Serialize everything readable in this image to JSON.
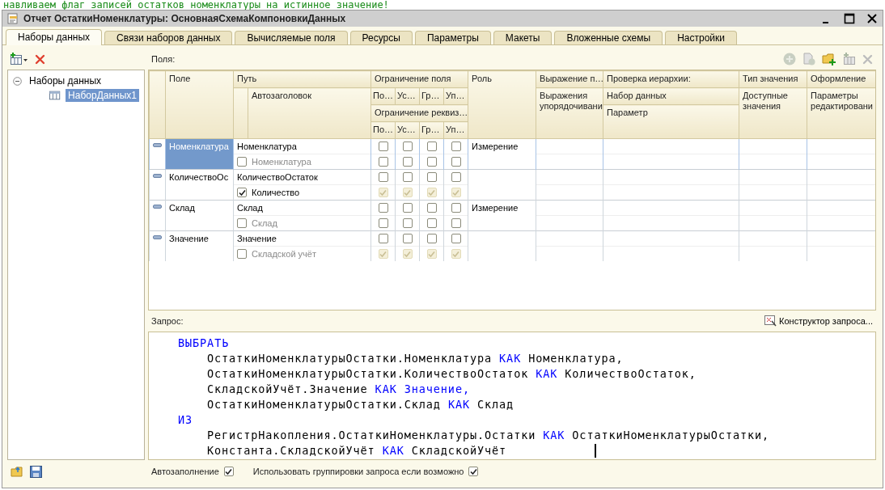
{
  "caption_above": "навливаем флаг записей остатков номенклатуры на истинное значение!",
  "window": {
    "title": "Отчет ОстаткиНоменклатуры: ОсновнаяСхемаКомпоновкиДанных"
  },
  "tabs": [
    {
      "label": "Наборы данных",
      "selected": true
    },
    {
      "label": "Связи наборов данных",
      "selected": false
    },
    {
      "label": "Вычисляемые поля",
      "selected": false
    },
    {
      "label": "Ресурсы",
      "selected": false
    },
    {
      "label": "Параметры",
      "selected": false
    },
    {
      "label": "Макеты",
      "selected": false
    },
    {
      "label": "Вложенные схемы",
      "selected": false
    },
    {
      "label": "Настройки",
      "selected": false
    }
  ],
  "tree": {
    "label": "Наборы данных",
    "expanded": true,
    "children": [
      {
        "label": "НаборДанных1",
        "selected": true
      }
    ]
  },
  "fields_label": "Поля:",
  "table": {
    "header": {
      "field": "Поле",
      "path": "Путь",
      "title": "Автозаголовок",
      "field_restriction": "Ограничение поля",
      "field_restriction_columns": [
        "По…",
        "Ус…",
        "Гр…",
        "Уп…"
      ],
      "attr_restriction": "Ограничение реквиз…",
      "attr_restriction_columns": [
        "По…",
        "Ус…",
        "Гр…",
        "Уп…"
      ],
      "role": "Роль",
      "expression": "Выражение п…",
      "order_expression": "Выражения упорядочивани",
      "hierarchy": "Проверка иерархии:",
      "hierarchy_set": "Набор данных",
      "hierarchy_param": "Параметр",
      "value_type": "Тип значения",
      "available_values": "Доступные значения",
      "appearance": "Оформление",
      "edit_params": "Параметры редактировани"
    },
    "rows": [
      {
        "field": "Номенклатура",
        "selected": true,
        "path": "Номенклатура",
        "title": "Номенклатура",
        "title_checked": false,
        "field_restrictions": [
          {
            "checked": false
          },
          {
            "checked": false
          },
          {
            "checked": false
          },
          {
            "checked": false
          }
        ],
        "attr_restrictions": [
          {
            "checked": false,
            "disabled": false
          },
          {
            "checked": false,
            "disabled": false
          },
          {
            "checked": false,
            "disabled": false
          },
          {
            "checked": false,
            "disabled": false
          }
        ],
        "role": "Измерение"
      },
      {
        "field": "КоличествоОс",
        "selected": false,
        "path": "КоличествоОстаток",
        "title": "Количество",
        "title_checked": true,
        "field_restrictions": [
          {
            "checked": false
          },
          {
            "checked": false
          },
          {
            "checked": false
          },
          {
            "checked": false
          }
        ],
        "attr_restrictions": [
          {
            "checked": true,
            "disabled": true
          },
          {
            "checked": true,
            "disabled": true
          },
          {
            "checked": true,
            "disabled": true
          },
          {
            "checked": true,
            "disabled": true
          }
        ]
      },
      {
        "field": "Склад",
        "selected": false,
        "path": "Склад",
        "title": "Склад",
        "title_checked": false,
        "field_restrictions": [
          {
            "checked": false
          },
          {
            "checked": false
          },
          {
            "checked": false
          },
          {
            "checked": false
          }
        ],
        "attr_restrictions": [
          {
            "checked": false,
            "disabled": false
          },
          {
            "checked": false,
            "disabled": false
          },
          {
            "checked": false,
            "disabled": false
          },
          {
            "checked": false,
            "disabled": false
          }
        ],
        "role": "Измерение"
      },
      {
        "field": "Значение",
        "selected": false,
        "path": "Значение",
        "title": "Складской учёт",
        "title_checked": false,
        "field_restrictions": [
          {
            "checked": false
          },
          {
            "checked": false
          },
          {
            "checked": false
          },
          {
            "checked": false
          }
        ],
        "attr_restrictions": [
          {
            "checked": true,
            "disabled": true
          },
          {
            "checked": true,
            "disabled": true
          },
          {
            "checked": true,
            "disabled": true
          },
          {
            "checked": true,
            "disabled": true
          }
        ]
      }
    ]
  },
  "query": {
    "label": "Запрос:",
    "constructor": "Конструктор запроса...",
    "lines": [
      {
        "indented": false,
        "tokens": [
          {
            "text": "ВЫБРАТЬ",
            "kind": "keyword"
          }
        ]
      },
      {
        "indented": true,
        "tokens": [
          {
            "text": "ОстаткиНоменклатурыОстатки.Номенклатура",
            "kind": "name"
          },
          {
            "text": "КАК",
            "kind": "keyword"
          },
          {
            "text": "Номенклатура,",
            "kind": "name"
          }
        ]
      },
      {
        "indented": true,
        "tokens": [
          {
            "text": "ОстаткиНоменклатурыОстатки.КоличествоОстаток",
            "kind": "name"
          },
          {
            "text": "КАК",
            "kind": "keyword"
          },
          {
            "text": "КоличествоОстаток,",
            "kind": "name"
          }
        ]
      },
      {
        "indented": true,
        "tokens": [
          {
            "text": "СкладскойУчёт.Значение",
            "kind": "name"
          },
          {
            "text": "КАК",
            "kind": "keyword"
          },
          {
            "text": "Значение,",
            "kind": "keyword"
          }
        ]
      },
      {
        "indented": true,
        "tokens": [
          {
            "text": "ОстаткиНоменклатурыОстатки.Склад",
            "kind": "name"
          },
          {
            "text": "КАК",
            "kind": "keyword"
          },
          {
            "text": "Склад",
            "kind": "name"
          }
        ]
      },
      {
        "indented": false,
        "tokens": [
          {
            "text": "ИЗ",
            "kind": "keyword"
          }
        ]
      },
      {
        "indented": true,
        "tokens": [
          {
            "text": "РегистрНакопления.ОстаткиНоменклатуры.Остатки",
            "kind": "name"
          },
          {
            "text": "КАК",
            "kind": "keyword"
          },
          {
            "text": "ОстаткиНоменклатурыОстатки,",
            "kind": "name"
          }
        ]
      },
      {
        "indented": true,
        "cursor": true,
        "tokens": [
          {
            "text": "Константа.СкладскойУчёт",
            "kind": "name"
          },
          {
            "text": "КАК",
            "kind": "keyword"
          },
          {
            "text": "СкладскойУчёт",
            "kind": "name"
          }
        ]
      }
    ]
  },
  "options": [
    {
      "label": "Автозаполнение",
      "checked": true
    },
    {
      "label": "Использовать группировки запроса если возможно",
      "checked": true
    }
  ]
}
